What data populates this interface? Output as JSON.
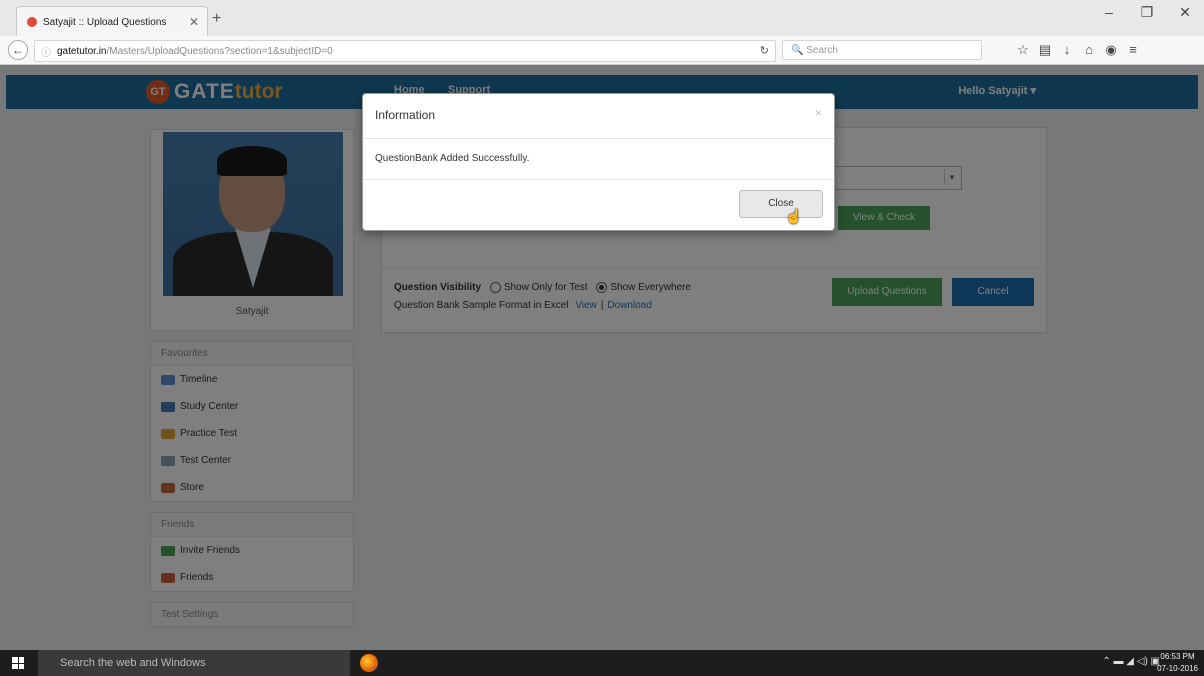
{
  "browser": {
    "tab_title": "Satyajit :: Upload Questions",
    "url_host": "gatetutor.in",
    "url_path": "/Masters/UploadQuestions?section=1&subjectID=0",
    "search_placeholder": "Search"
  },
  "site": {
    "logo_badge": "GT",
    "logo_gate": "GATE",
    "logo_tutor": "tutor",
    "nav": [
      "Home",
      "Support"
    ],
    "greeting": "Hello Satyajit ▾"
  },
  "sidebar": {
    "profile_name": "Satyajit",
    "favourites_title": "Favourites",
    "favourites": [
      "Timeline",
      "Study Center",
      "Practice Test",
      "Test Center",
      "Store"
    ],
    "friends_title": "Friends",
    "friends": [
      "Invite Friends",
      "Friends"
    ],
    "settings_title": "Test Settings"
  },
  "content": {
    "view_check": "View & Check",
    "question_visibility_label": "Question Visibility",
    "option_test": "Show Only for Test",
    "option_everywhere": "Show Everywhere",
    "sample_format": "Question Bank Sample Format in Excel",
    "view_link": "View",
    "download_link": "Download",
    "upload_btn": "Upload Questions",
    "cancel_btn": "Cancel"
  },
  "modal": {
    "title": "Information",
    "close_x": "×",
    "message": "QuestionBank Added Successfully.",
    "close_btn": "Close"
  },
  "taskbar": {
    "search_text": "Search the web and Windows",
    "time": "06:53 PM",
    "date": "07-10-2016"
  },
  "colors": {
    "nav_blue": "#1e6e9e",
    "green": "#4aa35a",
    "cancel_blue": "#1e6fb0"
  }
}
